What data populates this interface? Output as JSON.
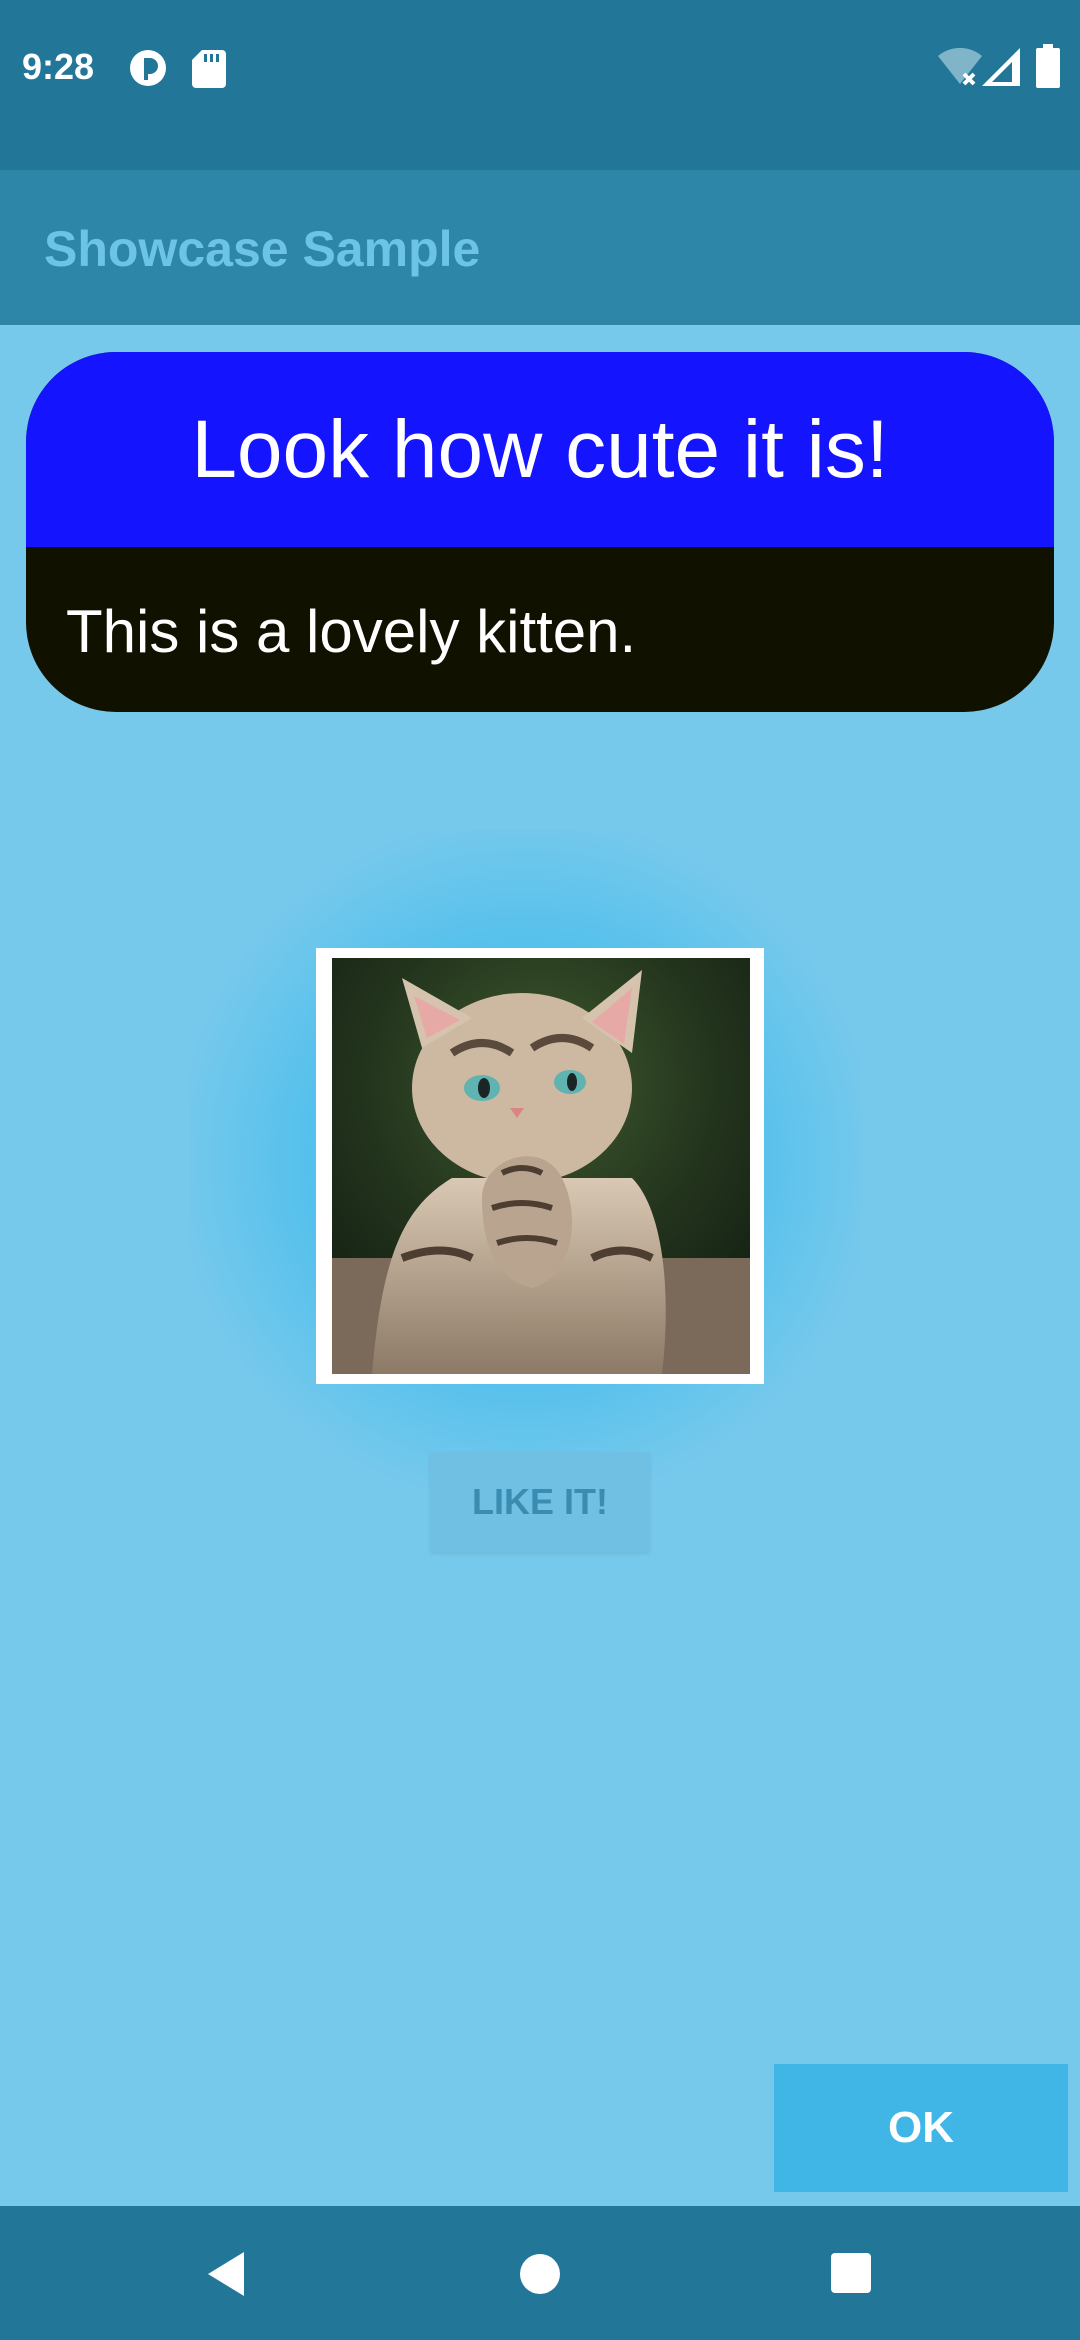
{
  "status_bar": {
    "time": "9:28",
    "icons": [
      "circle-notification-icon",
      "sd-card-icon",
      "wifi-off-icon",
      "cell-signal-icon",
      "battery-icon"
    ]
  },
  "app_bar": {
    "title": "Showcase Sample"
  },
  "showcase": {
    "title": "Look how cute it is!",
    "description": "This is a lovely kitten."
  },
  "content": {
    "like_button": "LIKE IT!"
  },
  "actions": {
    "ok_button": "OK"
  },
  "nav_bar": {
    "icons": [
      "back-icon",
      "home-icon",
      "recents-icon"
    ]
  },
  "colors": {
    "background": "#77c9ec",
    "status_bar": "#227799",
    "app_bar": "#2d86a8",
    "tooltip_title_bg": "#1414ff",
    "tooltip_body_bg": "#111100",
    "ok_button": "#3fb6e6"
  }
}
